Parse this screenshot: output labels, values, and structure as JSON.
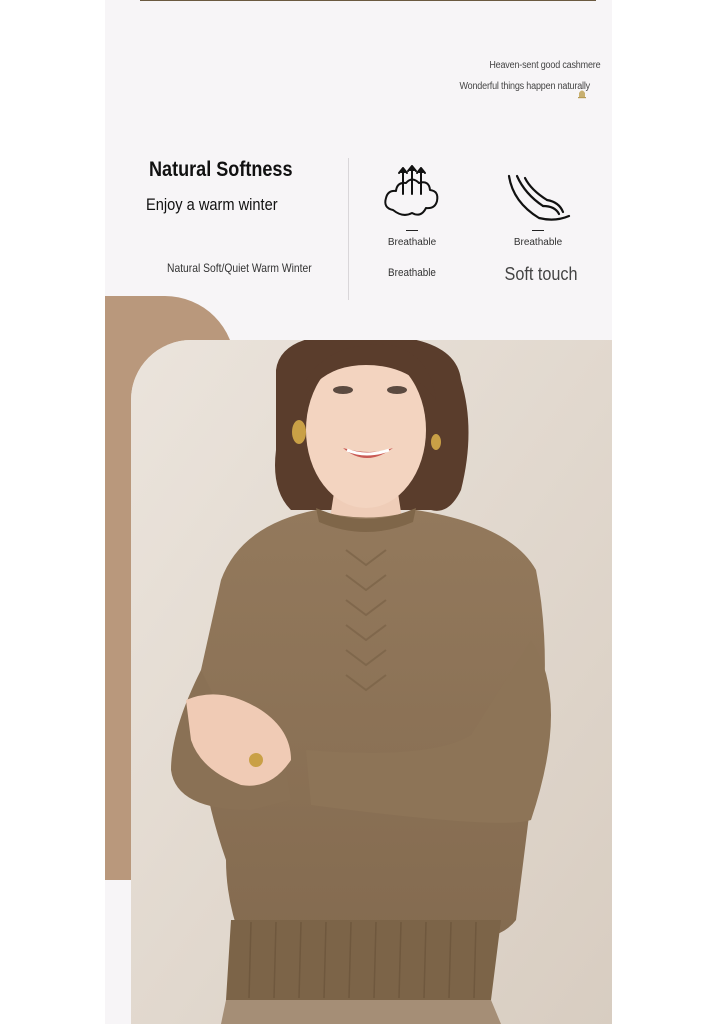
{
  "header": {
    "tagline_1": "Heaven-sent good cashmere",
    "tagline_2": "Wonderful things happen naturally"
  },
  "intro": {
    "title": "Natural Softness",
    "subtitle": "Enjoy a warm winter",
    "note": "Natural Soft/Quiet Warm Winter"
  },
  "features": [
    {
      "icon": "breathable-cloud-icon",
      "label": "Breathable",
      "sub": "Breathable"
    },
    {
      "icon": "soft-feather-icon",
      "label": "Breathable",
      "sub": "Soft touch"
    }
  ],
  "colors": {
    "accent_tan": "#b9987c",
    "sweater": "#8c7559",
    "background": "#f7f5f7"
  }
}
